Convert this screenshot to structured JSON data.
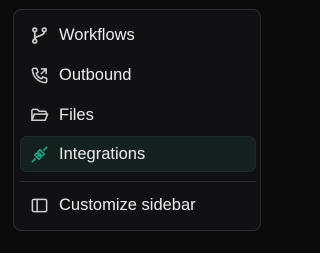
{
  "menu": {
    "items": [
      {
        "label": "Workflows",
        "icon": "git-branch-icon"
      },
      {
        "label": "Outbound",
        "icon": "phone-outgoing-icon"
      },
      {
        "label": "Files",
        "icon": "folder-open-icon"
      },
      {
        "label": "Integrations",
        "icon": "plug-icon",
        "active": true
      }
    ],
    "footer_item": {
      "label": "Customize sidebar",
      "icon": "sidebar-panel-icon"
    }
  },
  "colors": {
    "background": "#0b0b0c",
    "panel": "#111113",
    "active_bg": "#15211e",
    "accent": "#1fa386",
    "text": "#ececec"
  }
}
